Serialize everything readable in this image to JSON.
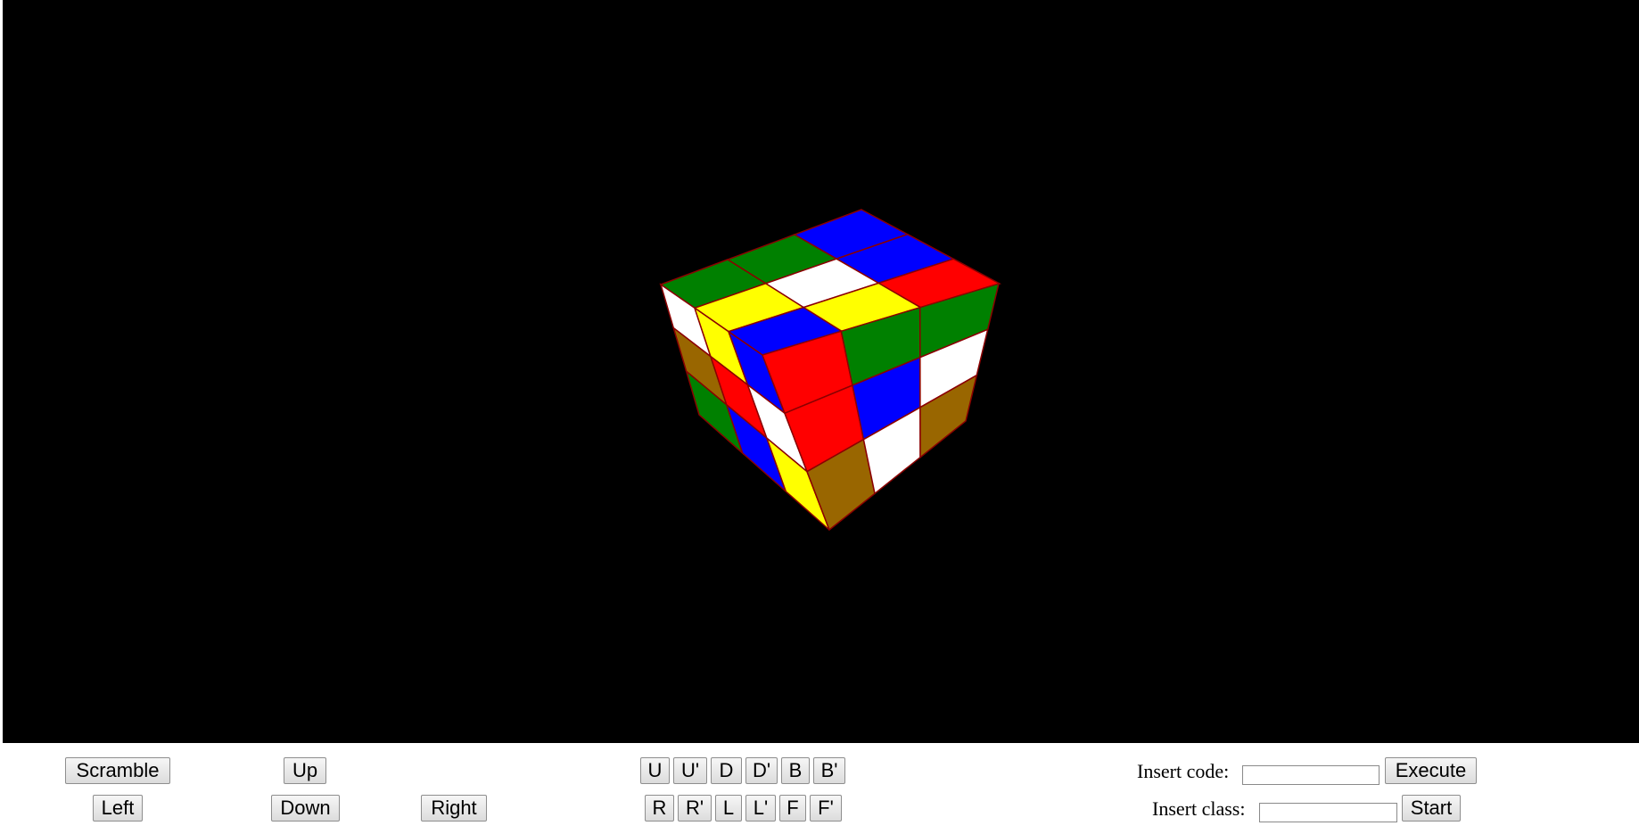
{
  "cube": {
    "colors": {
      "W": "#ffffff",
      "Y": "#ffff00",
      "R": "#ff0000",
      "G": "#008000",
      "B": "#0000ff",
      "O": "#996600"
    },
    "edge_color": "#8b0000",
    "faces": {
      "top": [
        [
          "B",
          "B",
          "R"
        ],
        [
          "G",
          "W",
          "Y"
        ],
        [
          "G",
          "Y",
          "B"
        ]
      ],
      "left": [
        [
          "W",
          "Y",
          "B"
        ],
        [
          "O",
          "R",
          "W"
        ],
        [
          "G",
          "B",
          "Y"
        ]
      ],
      "right": [
        [
          "R",
          "G",
          "G"
        ],
        [
          "R",
          "B",
          "W"
        ],
        [
          "O",
          "W",
          "O"
        ]
      ]
    }
  },
  "controls": {
    "scramble": "Scramble",
    "up": "Up",
    "left": "Left",
    "down": "Down",
    "right": "Right",
    "moves_row1": [
      "U",
      "U'",
      "D",
      "D'",
      "B",
      "B'"
    ],
    "moves_row2": [
      "R",
      "R'",
      "L",
      "L'",
      "F",
      "F'"
    ],
    "insert_code_label": "Insert code:",
    "execute": "Execute",
    "insert_class_label": "Insert class:",
    "start": "Start",
    "code_value": "",
    "class_value": ""
  }
}
